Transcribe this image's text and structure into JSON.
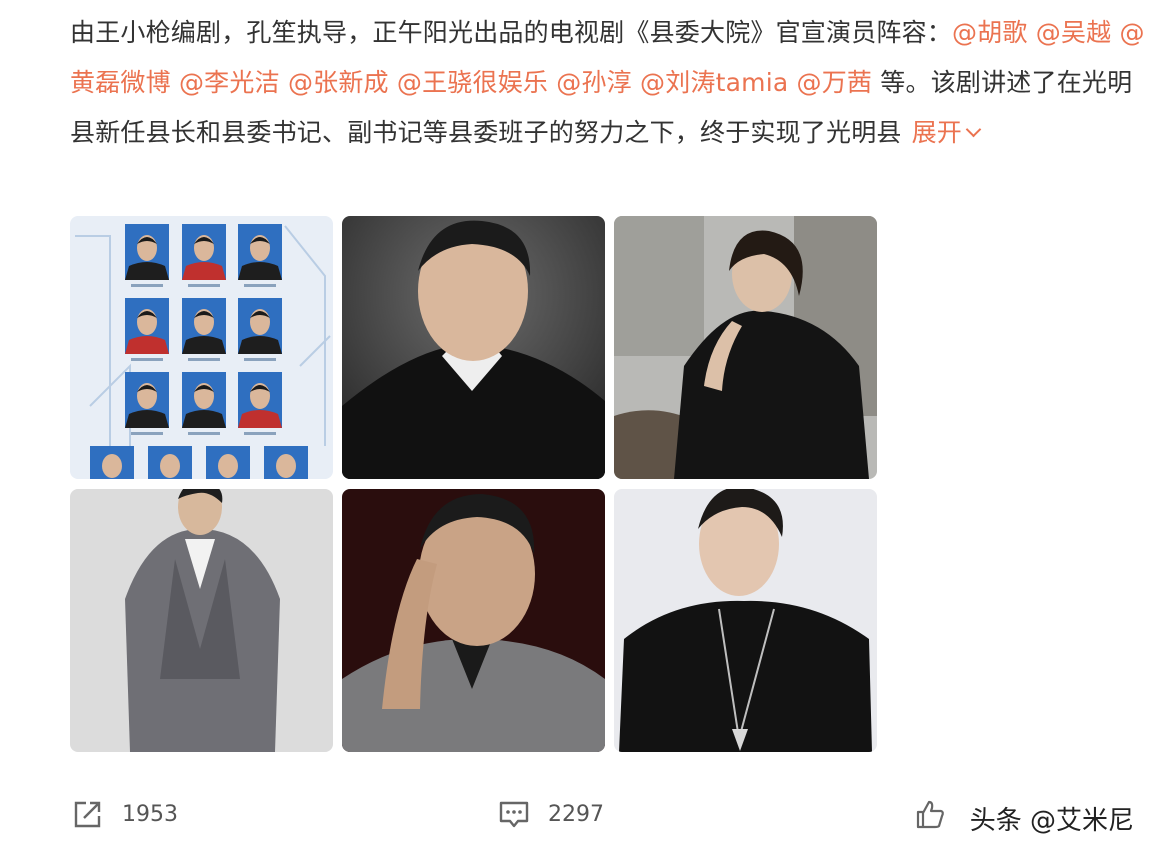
{
  "post": {
    "segments": [
      {
        "text": "由王小枪编剧，孔笙执导，正午阳光出品的电视剧《县委大院》官宣演员阵容：",
        "type": "plain"
      },
      {
        "text": "@胡歌",
        "type": "mention"
      },
      {
        "text": " ",
        "type": "plain"
      },
      {
        "text": "@吴越",
        "type": "mention"
      },
      {
        "text": " ",
        "type": "plain"
      },
      {
        "text": "@黄磊微博",
        "type": "mention"
      },
      {
        "text": " ",
        "type": "plain"
      },
      {
        "text": "@李光洁",
        "type": "mention"
      },
      {
        "text": " ",
        "type": "plain"
      },
      {
        "text": "@张新成",
        "type": "mention"
      },
      {
        "text": " ",
        "type": "plain"
      },
      {
        "text": "@王骁很娱乐",
        "type": "mention"
      },
      {
        "text": " ",
        "type": "plain"
      },
      {
        "text": "@孙淳",
        "type": "mention"
      },
      {
        "text": " ",
        "type": "plain"
      },
      {
        "text": "@刘涛tamia",
        "type": "mention"
      },
      {
        "text": " ",
        "type": "plain"
      },
      {
        "text": "@万茜",
        "type": "mention"
      },
      {
        "text": " 等。该剧讲述了在光明县新任县长和县委书记、副书记等县委班子的努力之下，终于实现了光明县",
        "type": "plain"
      }
    ],
    "expand_label": "展开"
  },
  "photos": [
    {
      "name": "cast-poster-photo"
    },
    {
      "name": "actor-portrait-1"
    },
    {
      "name": "actress-portrait"
    },
    {
      "name": "actor-portrait-suit"
    },
    {
      "name": "actor-portrait-hand"
    },
    {
      "name": "actor-portrait-young"
    }
  ],
  "actions": {
    "share_count": "1953",
    "comment_count": "2297",
    "share_icon": "share-icon",
    "comment_icon": "comment-icon",
    "like_icon": "thumbs-up-icon"
  },
  "watermark": "头条 @艾米尼",
  "colors": {
    "mention": "#eb7350",
    "text": "#333333"
  }
}
